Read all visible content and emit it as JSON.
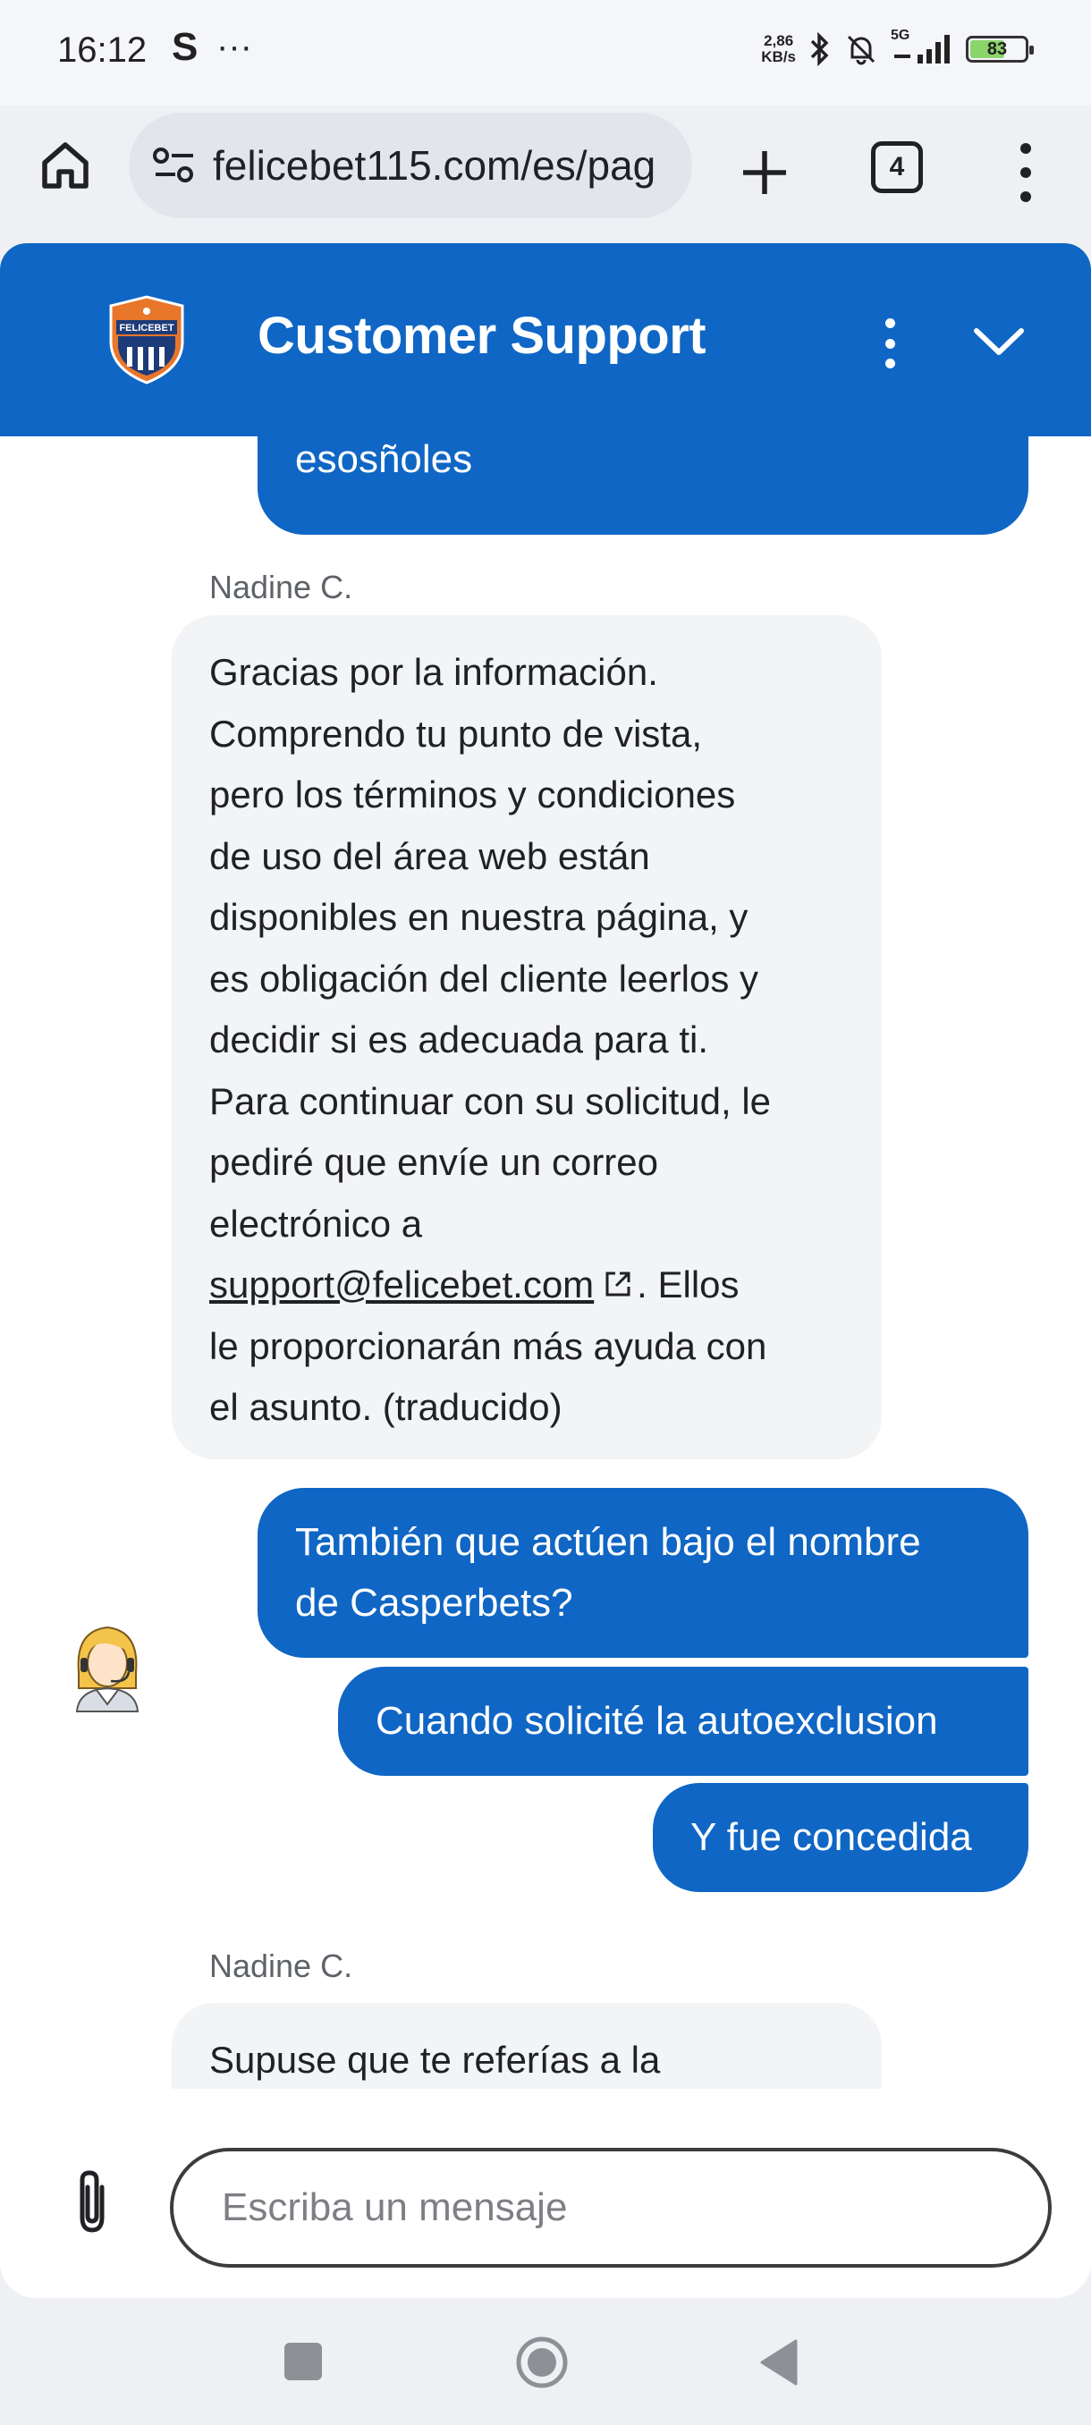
{
  "status_bar": {
    "time": "16:12",
    "carrier_icon": "S",
    "more": "···",
    "net_speed_value": "2,86",
    "net_speed_unit": "KB/s",
    "network_type": "5G",
    "battery": "83",
    "icons": [
      "bluetooth-icon",
      "muted-bell-icon",
      "signal-icon",
      "battery-icon"
    ]
  },
  "browser": {
    "url": "felicebet115.com/es/pag",
    "tab_count": "4",
    "icons": [
      "home-icon",
      "site-settings-icon",
      "new-tab-icon",
      "tab-switcher-icon",
      "more-menu-icon"
    ]
  },
  "chat": {
    "header_title": "Customer Support",
    "logo_text": "FELICEBET",
    "accent_color": "#0f66c4",
    "messages": [
      {
        "from": "user",
        "text": "esosñoles"
      },
      {
        "from": "agent",
        "name": "Nadine C.",
        "lines": [
          "Gracias por la información.",
          "Comprendo tu punto de vista,",
          "pero los términos y condiciones",
          "de uso del área web están",
          "disponibles en nuestra página, y",
          "es obligación del cliente leerlos y",
          "decidir si es adecuada para ti.",
          "Para continuar con su solicitud, le",
          "pediré que envíe un correo",
          "electrónico a"
        ],
        "email": "support@felicebet.com",
        "after_email": ". Ellos",
        "lines_after": [
          "le proporcionarán más ayuda con",
          "el asunto.  (traducido)"
        ]
      },
      {
        "from": "user",
        "lines": [
          "También que actúen bajo el nombre",
          "de Casperbets?"
        ]
      },
      {
        "from": "user",
        "text": "Cuando solicité la autoexclusion"
      },
      {
        "from": "user",
        "text": "Y fue concedida"
      },
      {
        "from": "agent",
        "name": "Nadine C.",
        "text": "Supuse que te referías a la"
      }
    ],
    "composer": {
      "placeholder": "Escriba un mensaje"
    }
  }
}
